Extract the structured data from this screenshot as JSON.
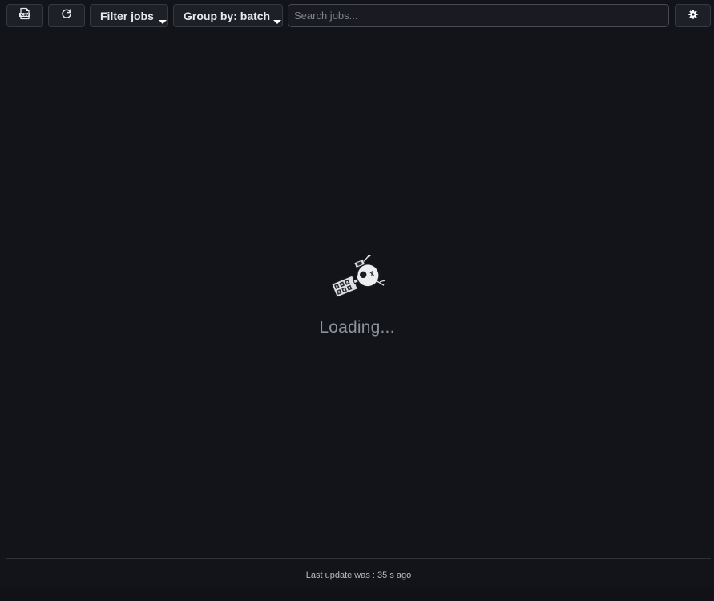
{
  "toolbar": {
    "export_icon": "csv-file-icon",
    "refresh_icon": "refresh-icon",
    "filter_label": "Filter jobs",
    "group_label": "Group by: batch",
    "search_placeholder": "Search jobs...",
    "search_value": "",
    "settings_icon": "gear-icon"
  },
  "main": {
    "loading_image": "satellite-illustration",
    "loading_text": "Loading..."
  },
  "footer": {
    "status_text": "Last update was : 35 s ago"
  },
  "colors": {
    "background": "#131419",
    "button_bg": "#1d2027",
    "button_border": "#343943",
    "muted_text": "#8b93a0"
  }
}
